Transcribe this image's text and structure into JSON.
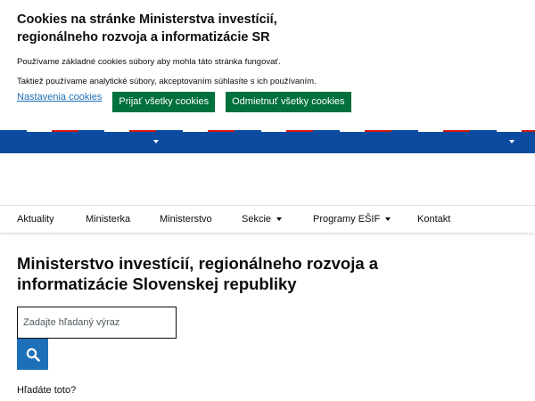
{
  "cookie_banner": {
    "title": "Cookies na stránke Ministerstva investícií, regionálneho rozvoja a informatizácie SR",
    "text_basic": "Používame základné cookies súbory aby mohla táto stránka fungovať.",
    "text_analytics": "Taktiež používame analytické súbory, akceptovaním súhlasíte s ich používaním.",
    "settings_link": "Nastavenia cookies",
    "accept_all_label": "Prijať všetky cookies",
    "reject_all_label": "Odmietnuť všetky cookies"
  },
  "nav": {
    "items": [
      {
        "label": "Aktuality"
      },
      {
        "label": "Ministerka"
      },
      {
        "label": "Ministerstvo"
      },
      {
        "label": "Sekcie"
      },
      {
        "label": "Programy EŠIF"
      },
      {
        "label": "Kontakt"
      }
    ]
  },
  "main": {
    "title": "Ministerstvo investícií, regionálneho rozvoja a informatizácie Slovenskej republiky",
    "search_placeholder": "Zadajte hľadaný výraz",
    "search_hint": "Hľadáte toto?"
  },
  "icons": {
    "search": "search-icon",
    "dropdown": "caret-down-icon"
  },
  "colors": {
    "accent_green": "#00703c",
    "header_blue": "#0b4ca0",
    "link_blue": "#1d70b8",
    "flag_red": "#d0190f"
  }
}
